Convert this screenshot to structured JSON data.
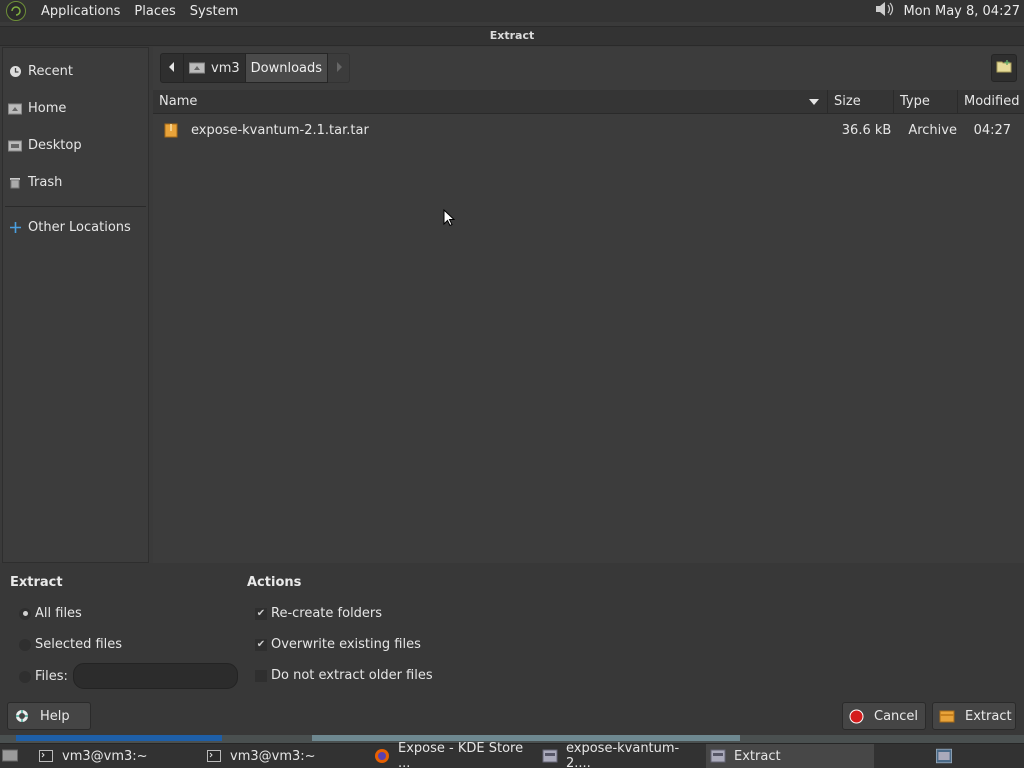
{
  "top_panel": {
    "menus": [
      "Applications",
      "Places",
      "System"
    ],
    "clock": "Mon May  8, 04:27"
  },
  "dialog": {
    "title": "Extract"
  },
  "sidebar": {
    "items": [
      {
        "label": "Recent",
        "icon": "clock-icon"
      },
      {
        "label": "Home",
        "icon": "home-icon"
      },
      {
        "label": "Desktop",
        "icon": "desktop-icon"
      },
      {
        "label": "Trash",
        "icon": "trash-icon"
      }
    ],
    "other": {
      "label": "Other Locations",
      "icon": "plus-icon"
    }
  },
  "pathbar": {
    "segments": [
      "vm3",
      "Downloads"
    ]
  },
  "file_list": {
    "columns": [
      "Name",
      "Size",
      "Type",
      "Modified"
    ],
    "rows": [
      {
        "name": "expose-kvantum-2.1.tar.tar",
        "size": "36.6 kB",
        "type": "Archive",
        "modified": "04:27"
      }
    ]
  },
  "extract_options": {
    "heading": "Extract",
    "all_files": "All files",
    "selected_files": "Selected files",
    "files": "Files:",
    "files_value": ""
  },
  "actions": {
    "heading": "Actions",
    "recreate": "Re-create folders",
    "overwrite": "Overwrite existing files",
    "no_older": "Do not extract older files"
  },
  "buttons": {
    "help": "Help",
    "cancel": "Cancel",
    "extract": "Extract"
  },
  "taskbar": {
    "tasks": [
      "vm3@vm3:~",
      "vm3@vm3:~",
      "Expose - KDE Store ...",
      "expose-kvantum-2....",
      "Extract"
    ]
  },
  "colors": {
    "accent_blue": "#1e5fa8",
    "cancel_red": "#d41c1c",
    "folder_orange": "#e8a33a"
  }
}
